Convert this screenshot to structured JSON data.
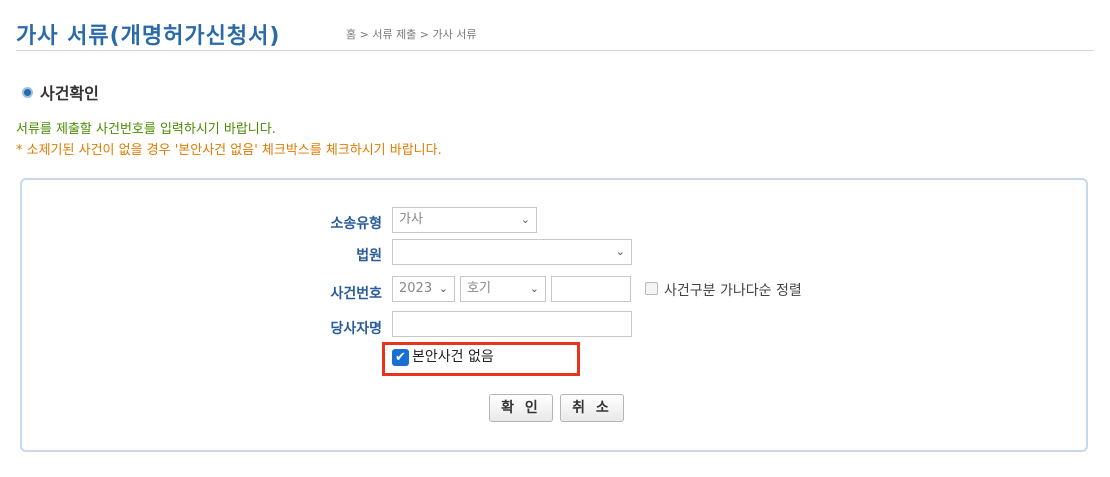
{
  "header": {
    "title": "가사 서류(개명허가신청서)",
    "breadcrumb": "홈 > 서류 제출 > 가사 서류"
  },
  "section": {
    "title": "사건확인"
  },
  "notices": {
    "line1": "서류를 제출할 사건번호를 입력하시기 바랍니다.",
    "line2": "* 소제기된 사건이 없을 경우 '본안사건 없음' 체크박스를 체크하시기 바랍니다."
  },
  "form": {
    "case_type": {
      "label": "소송유형",
      "value": "가사"
    },
    "court": {
      "label": "법원",
      "value": ""
    },
    "case_number": {
      "label": "사건번호",
      "year": "2023",
      "code": "호기",
      "number": "",
      "sort_label": "사건구분 가나다순 정렬",
      "sort_checked": false
    },
    "party_name": {
      "label": "당사자명",
      "value": ""
    },
    "no_main_case": {
      "label": "본안사건 없음",
      "checked": true
    },
    "confirm_button": "확 인",
    "cancel_button": "취 소"
  },
  "colors": {
    "title": "#2a6aa8",
    "label": "#2a5c9a",
    "notice_green": "#4a8b00",
    "notice_orange": "#e07b00",
    "highlight": "#e8341c",
    "checkbox": "#1a6fd6"
  }
}
